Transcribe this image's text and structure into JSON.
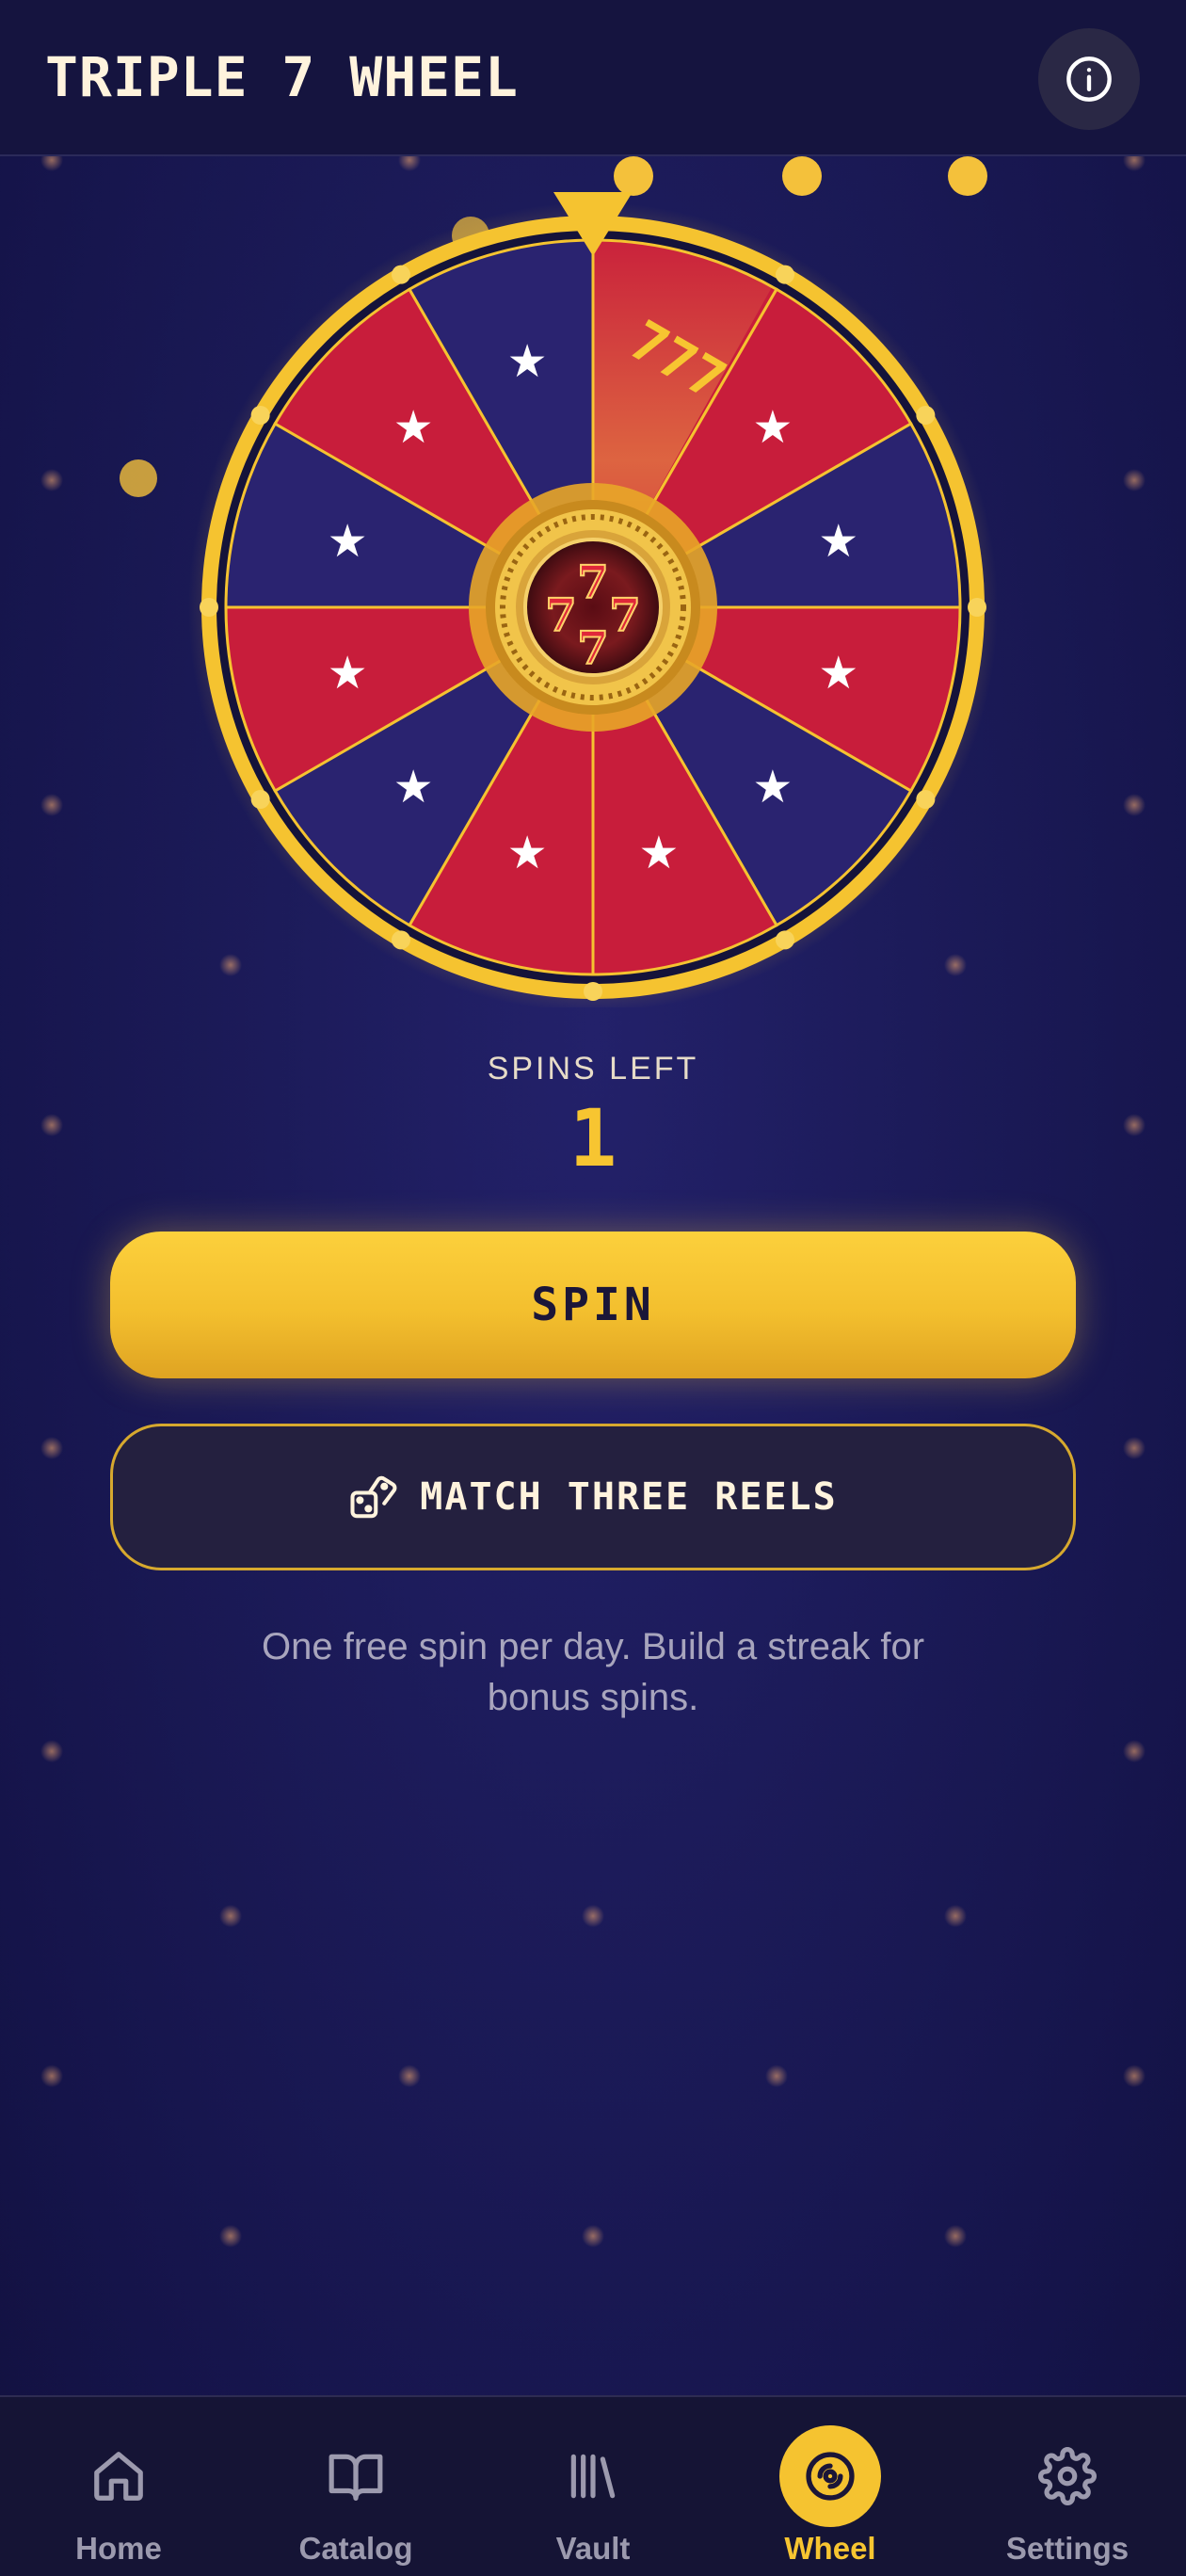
{
  "header": {
    "title": "TRIPLE 7 WHEEL",
    "info_icon": "info-icon"
  },
  "wheel": {
    "segment_count": 12,
    "center_label": "777",
    "colors": {
      "red": "#c81d3b",
      "navy": "#2a2370",
      "gold": "#f5c330"
    }
  },
  "spins": {
    "label": "SPINS LEFT",
    "value": "1"
  },
  "actions": {
    "spin_label": "SPIN",
    "match_label": "MATCH THREE REELS",
    "match_icon": "dice-icon"
  },
  "note": "One free spin per day. Build a streak for bonus spins.",
  "nav": {
    "items": [
      {
        "label": "Home",
        "icon": "home-icon"
      },
      {
        "label": "Catalog",
        "icon": "book-icon"
      },
      {
        "label": "Vault",
        "icon": "library-icon"
      },
      {
        "label": "Wheel",
        "icon": "wheel-icon",
        "active": true
      },
      {
        "label": "Settings",
        "icon": "gear-icon"
      }
    ]
  }
}
